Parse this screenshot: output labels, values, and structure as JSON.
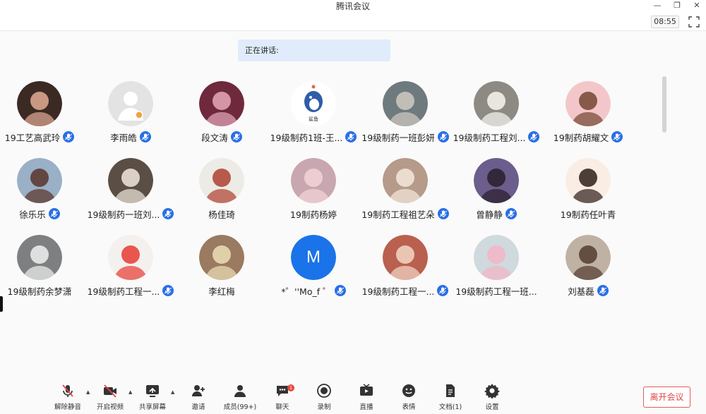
{
  "window": {
    "title": "腾讯会议"
  },
  "header": {
    "clock": "08:55"
  },
  "speaking": {
    "label": "正在讲话:"
  },
  "participants": [
    {
      "name": "19工艺高武玲",
      "mic": true,
      "avatar": "photo-selfie"
    },
    {
      "name": "李雨皓",
      "mic": true,
      "avatar": "default-person"
    },
    {
      "name": "段文涛",
      "mic": true,
      "avatar": "photo-pink-tree"
    },
    {
      "name": "19级制药1班-王...",
      "mic": true,
      "avatar": "cartoon-bird",
      "avatar_text": "鲨鱼"
    },
    {
      "name": "19级制药一班彭妍",
      "mic": true,
      "avatar": "photo-cat"
    },
    {
      "name": "19级制药工程刘...",
      "mic": true,
      "avatar": "photo-white-cat"
    },
    {
      "name": "19制药胡耀文",
      "mic": true,
      "avatar": "cartoon-girl"
    },
    {
      "name": "徐乐乐",
      "mic": true,
      "avatar": "photo-couple"
    },
    {
      "name": "19级制药一班刘...",
      "mic": true,
      "avatar": "photo-plush"
    },
    {
      "name": "杨佳琦",
      "mic": false,
      "avatar": "drawing-umbrella"
    },
    {
      "name": "19制药杨婷",
      "mic": false,
      "avatar": "anime-girl"
    },
    {
      "name": "19制药工程祖艺朵",
      "mic": true,
      "avatar": "photo-alpaca"
    },
    {
      "name": "曾静静",
      "mic": true,
      "avatar": "photo-woman"
    },
    {
      "name": "19制药任叶青",
      "mic": false,
      "avatar": "cartoon-flower"
    },
    {
      "name": "19级制药余梦潇",
      "mic": false,
      "avatar": "photo-astronaut"
    },
    {
      "name": "19级制药工程一...",
      "mic": true,
      "avatar": "cartoon-pig"
    },
    {
      "name": "李红梅",
      "mic": false,
      "avatar": "photo-child"
    },
    {
      "name": "*゜''Mo_f ゜",
      "mic": true,
      "avatar": "letter",
      "letter": "M"
    },
    {
      "name": "19级制药工程一...",
      "mic": true,
      "avatar": "photo-girl-wave"
    },
    {
      "name": "19级制药工程一班...",
      "mic": false,
      "avatar": "photo-pink-hair"
    },
    {
      "name": "刘基磊",
      "mic": true,
      "avatar": "photo-street"
    }
  ],
  "toolbar": {
    "unmute": "解除静音",
    "video": "开启视频",
    "share": "共享屏幕",
    "invite": "邀请",
    "members": "成员(99+)",
    "chat": "聊天",
    "chat_badge": "1",
    "record": "录制",
    "live": "直播",
    "emoji": "表情",
    "docs": "文档(1)",
    "settings": "设置",
    "leave": "离开会议"
  },
  "colors": {
    "accent": "#1a73e8",
    "danger": "#e04848",
    "speaking_bg": "#e0ecfb"
  }
}
